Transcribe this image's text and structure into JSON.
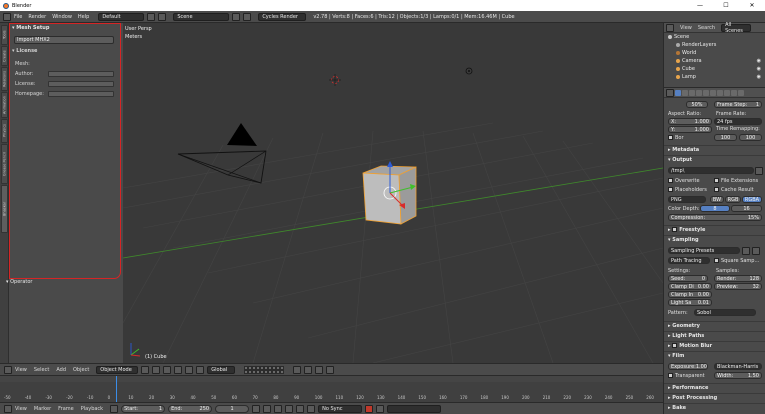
{
  "window": {
    "title": "Blender",
    "minimize": "—",
    "maximize": "☐",
    "close": "✕"
  },
  "infobar": {
    "menus": [
      "File",
      "Render",
      "Window",
      "Help"
    ],
    "layout": "Default",
    "scene": "Scene",
    "engine": "Cycles Render",
    "stats": "v2.78 | Verts:8 | Faces:6 | Tris:12 | Objects:1/3 | Lamps:0/1 | Mem:16.46M | Cube"
  },
  "toolshelf": {
    "tabs": [
      "Tools",
      "Create",
      "Relations",
      "Animation",
      "Physics",
      "Grease Pencil",
      "Bhaskar"
    ],
    "mesh_setup_title": "Mesh Setup",
    "import_button": "Import MHX2",
    "license_title": "License",
    "mesh_label": "Mesh:",
    "author_label": "Author:",
    "license_label": "License:",
    "homepage_label": "Homepage:",
    "operator_label": "Operator"
  },
  "viewport": {
    "view_name": "User Persp",
    "units": "Meters",
    "object_label": "(1) Cube"
  },
  "viewport_header": {
    "menus": [
      "View",
      "Select",
      "Add",
      "Object"
    ],
    "mode": "Object Mode",
    "orientation": "Global"
  },
  "timeline": {
    "ticks": [
      "-50",
      "-40",
      "-30",
      "-20",
      "-10",
      "0",
      "10",
      "20",
      "30",
      "40",
      "50",
      "60",
      "70",
      "80",
      "90",
      "100",
      "110",
      "120",
      "130",
      "140",
      "150",
      "160",
      "170",
      "180",
      "190",
      "200",
      "210",
      "220",
      "230",
      "240",
      "250",
      "260"
    ],
    "menus": [
      "View",
      "Marker",
      "Frame",
      "Playback"
    ],
    "start_label": "Start:",
    "start_value": "1",
    "end_label": "End:",
    "end_value": "250",
    "current": "1",
    "sync": "No Sync"
  },
  "outliner": {
    "tabs": [
      "View",
      "Search",
      "All Scenes"
    ],
    "items": [
      {
        "label": "Scene",
        "color": "#c8c8c8"
      },
      {
        "label": "RenderLayers",
        "color": "#aaaaaa"
      },
      {
        "label": "World",
        "color": "#b57636"
      },
      {
        "label": "Camera",
        "color": "#e8a54c"
      },
      {
        "label": "Cube",
        "color": "#e8a54c"
      },
      {
        "label": "Lamp",
        "color": "#e8a54c"
      }
    ]
  },
  "properties": {
    "percent": "50%",
    "frame_step_label": "Frame Step:",
    "frame_step_value": "1",
    "aspect_ratio_label": "Aspect Ratio:",
    "frame_rate_label": "Frame Rate:",
    "x_label": "X:",
    "x_value": "1.000",
    "y_label": "Y:",
    "y_value": "1.000",
    "fps": "24 fps",
    "time_remapping_label": "Time Remapping:",
    "remap_old": "100",
    "remap_new": "100",
    "border_label": "Bor",
    "metadata_title": "Metadata",
    "output_title": "Output",
    "output_path": "/tmp\\",
    "overwrite_label": "Overwrite",
    "file_ext_label": "File Extensions",
    "placeholders_label": "Placeholders",
    "cache_result_label": "Cache Result",
    "format": "PNG",
    "bw": "BW",
    "rgb": "RGB",
    "rgba": "RGBA",
    "color_depth_label": "Color Depth:",
    "depth_8": "8",
    "depth_16": "16",
    "compression_label": "Compression:",
    "compression_value": "15%",
    "freestyle_title": "Freestyle",
    "sampling_title": "Sampling",
    "sampling_presets": "Sampling Presets",
    "integrator": "Path Tracing",
    "square_samples": "Square Samp...",
    "settings_label": "Settings:",
    "samples_label": "Samples:",
    "seed_label": "Seed:",
    "seed_value": "0",
    "render_label": "Render:",
    "render_value": "128",
    "clamp_direct_label": "Clamp Di",
    "clamp_direct_value": "0.00",
    "preview_label": "Preview:",
    "preview_value": "32",
    "clamp_indirect_label": "Clamp In",
    "clamp_indirect_value": "0.00",
    "light_sampling_label": "Light Sa",
    "light_sampling_value": "0.01",
    "pattern_label": "Pattern:",
    "pattern_value": "Sobol",
    "geometry_title": "Geometry",
    "light_paths_title": "Light Paths",
    "motion_blur_title": "Motion Blur",
    "film_title": "Film",
    "exposure_label": "Exposure:",
    "exposure_value": "1.00",
    "filter": "Blackman-Harris",
    "transparent_label": "Transparent",
    "width_label": "Width:",
    "width_value": "1.50",
    "performance_title": "Performance",
    "post_processing_title": "Post Processing",
    "bake_title": "Bake"
  }
}
